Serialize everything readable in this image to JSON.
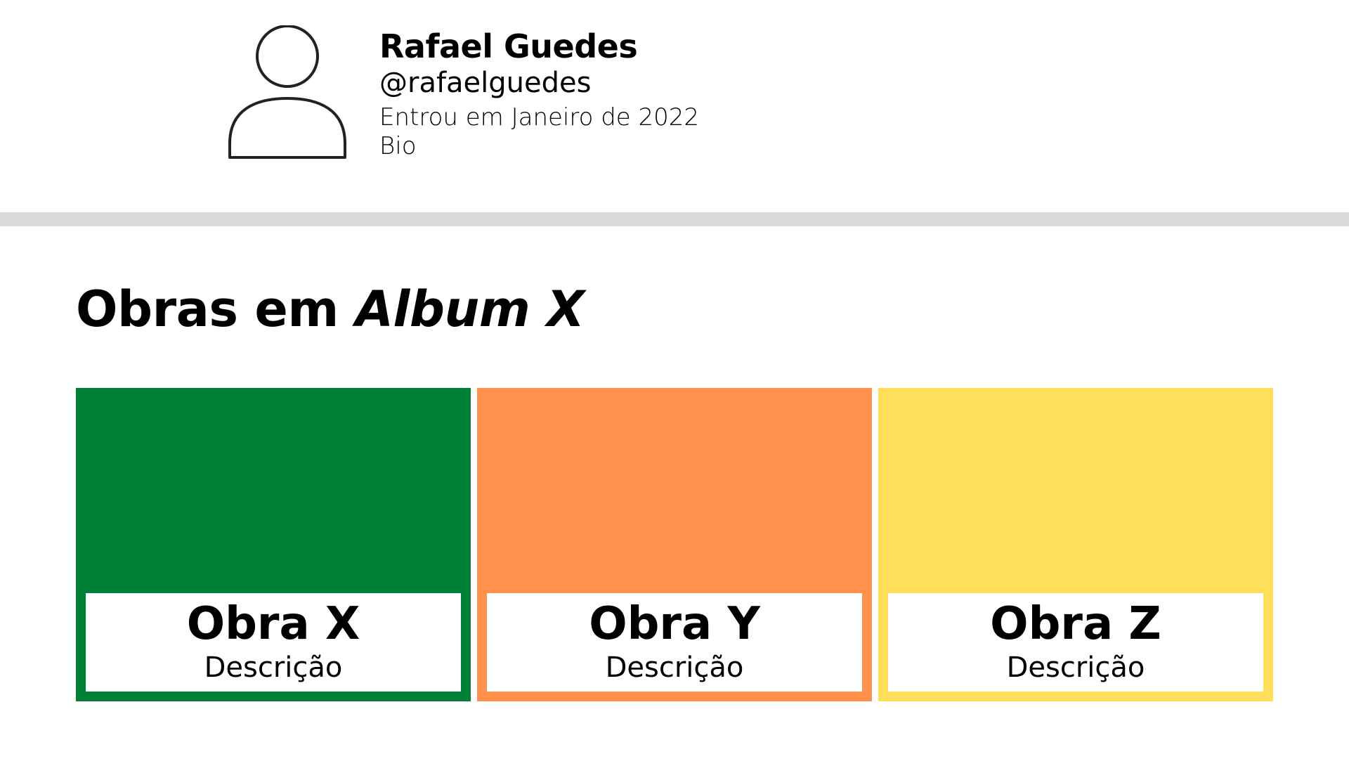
{
  "profile": {
    "avatar_icon": "user-avatar-icon",
    "name": "Rafael Guedes",
    "handle": "@rafaelguedes",
    "joined": "Entrou em Janeiro de 2022",
    "bio": "Bio"
  },
  "section": {
    "title_prefix": "Obras em",
    "album_name": "Album X"
  },
  "works": [
    {
      "title": "Obra X",
      "description": "Descrição",
      "color": "#008037"
    },
    {
      "title": "Obra Y",
      "description": "Descrição",
      "color": "#ff914d"
    },
    {
      "title": "Obra Z",
      "description": "Descrição",
      "color": "#ffde59"
    }
  ],
  "colors": {
    "divider": "#d9d9d9",
    "background": "#ffffff"
  }
}
